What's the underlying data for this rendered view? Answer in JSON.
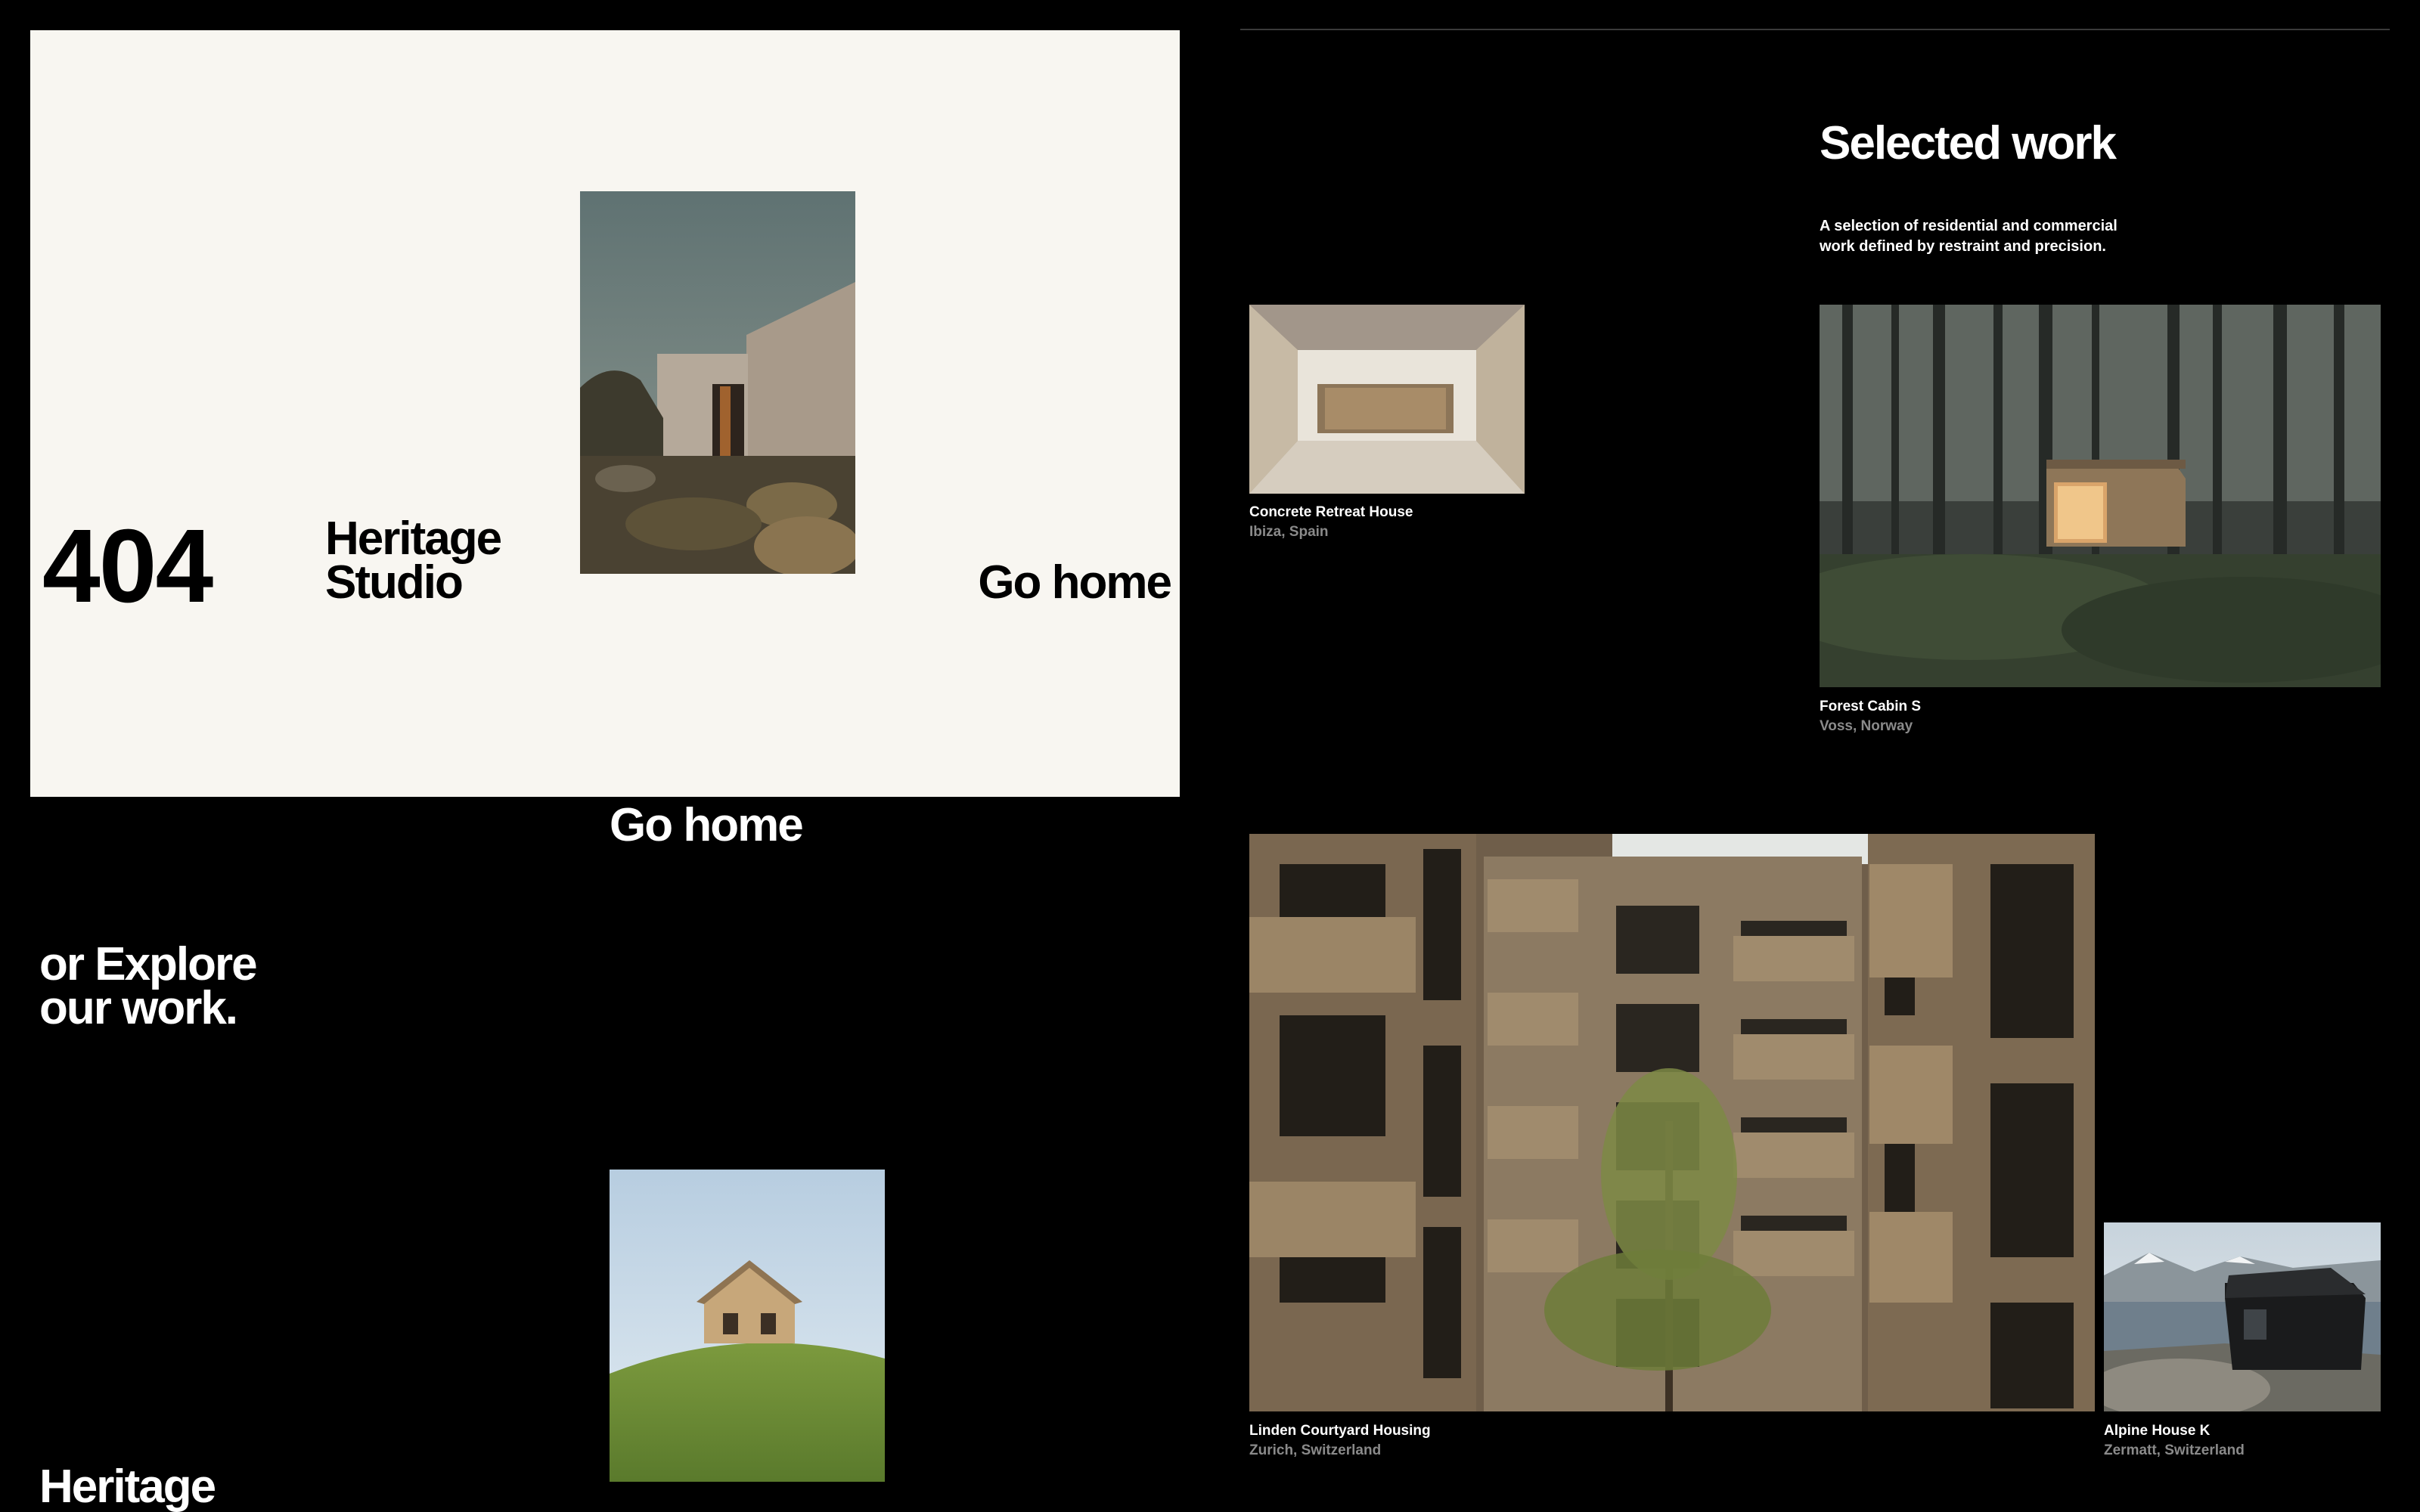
{
  "error": {
    "code": "404",
    "studio_line1": "Heritage",
    "studio_line2": "Studio",
    "go_home": "Go home"
  },
  "secondary": {
    "go_home": "Go home",
    "explore_line1": "or Explore",
    "explore_line2": "our work.",
    "footer_brand": "Heritage"
  },
  "work": {
    "title": "Selected work",
    "description": "A selection of residential and commercial work defined by restraint and precision.",
    "projects": [
      {
        "name": "Concrete Retreat House",
        "location": "Ibiza, Spain"
      },
      {
        "name": "Forest Cabin S",
        "location": "Voss, Norway"
      },
      {
        "name": "Linden Courtyard Housing",
        "location": "Zurich, Switzerland"
      },
      {
        "name": "Alpine House K",
        "location": "Zermatt, Switzerland"
      }
    ]
  },
  "colors": {
    "background": "#000000",
    "card": "#f8f6f1",
    "caption_muted": "#8a8a8a"
  }
}
